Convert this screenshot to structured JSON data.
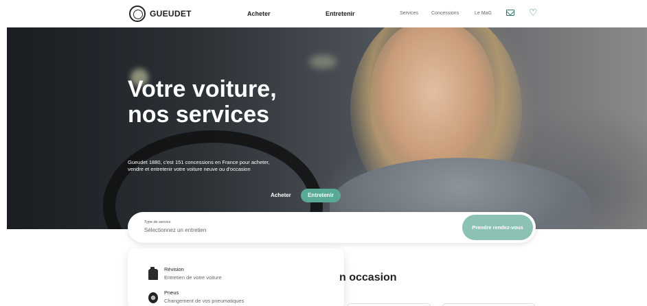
{
  "header": {
    "logo_text": "GUEUDET",
    "nav_main": [
      "Acheter",
      "Entretenir"
    ],
    "nav_sub": [
      "Services",
      "Concessions",
      "Le MaG"
    ],
    "icons": [
      "mail-icon",
      "heart-icon"
    ]
  },
  "hero": {
    "title": "Votre voiture, nos services",
    "description": "Gueudet 1880, c'est 151 concessions en France pour acheter, vendre et entretenir votre voiture neuve ou d'occasion",
    "button_acheter": "Acheter",
    "button_entretenir": "Entretenir"
  },
  "search": {
    "label": "Type de service",
    "value": "Sélectionnez un entretien",
    "submit_label": "Prendre rendez-vous"
  },
  "dropdown": {
    "items": [
      {
        "title": "Révision",
        "subtitle": "Entretien de votre voiture",
        "icon": "oil-can-icon"
      },
      {
        "title": "Pneus",
        "subtitle": "Changement de vos pneumatiques",
        "icon": "tire-icon"
      }
    ]
  },
  "section": {
    "heading_visible": "n occasion"
  },
  "colors": {
    "accent": "#5aa996",
    "accent_light": "#8cc2b3",
    "icon_accent": "#2f7a6a"
  }
}
